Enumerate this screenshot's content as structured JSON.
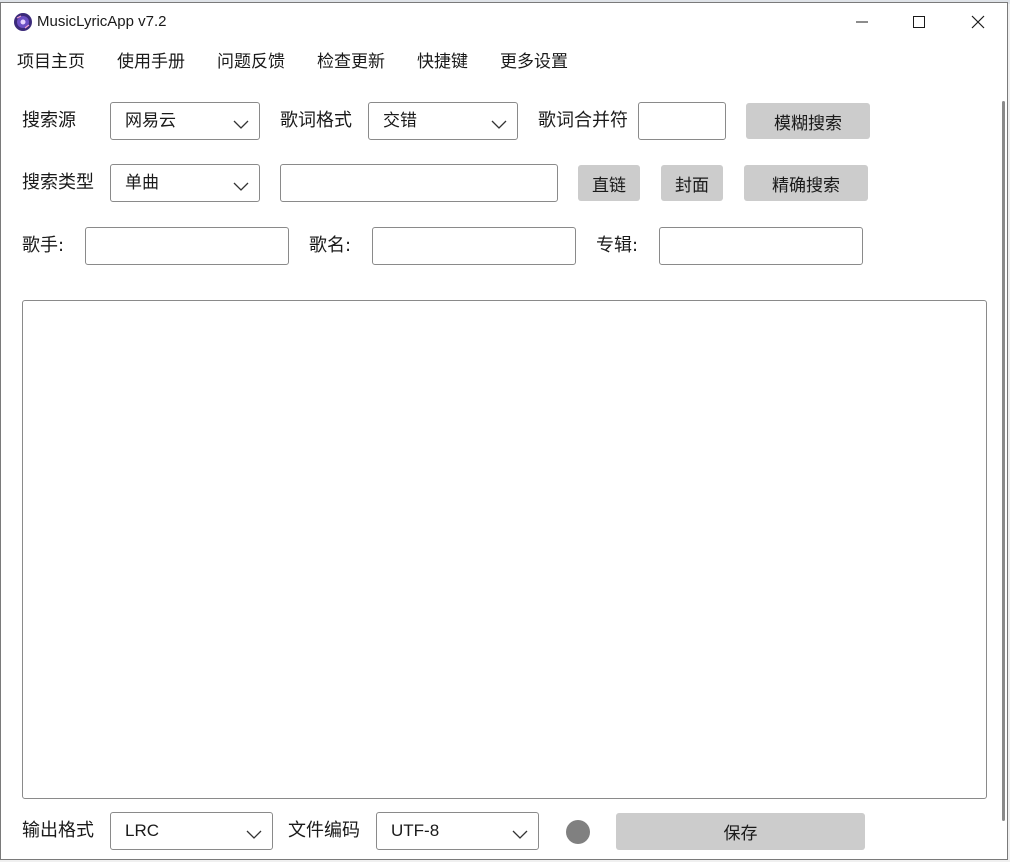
{
  "window": {
    "title": "MusicLyricApp v7.2"
  },
  "menu": {
    "items": [
      "项目主页",
      "使用手册",
      "问题反馈",
      "检查更新",
      "快捷键",
      "更多设置"
    ]
  },
  "search": {
    "source_label": "搜索源",
    "source_value": "网易云",
    "lyric_format_label": "歌词格式",
    "lyric_format_value": "交错",
    "merge_char_label": "歌词合并符",
    "merge_char_value": "",
    "fuzzy_search_label": "模糊搜索",
    "type_label": "搜索类型",
    "type_value": "单曲",
    "query_value": "",
    "direct_link_label": "直链",
    "cover_label": "封面",
    "exact_search_label": "精确搜索",
    "singer_label": "歌手:",
    "song_label": "歌名:",
    "album_label": "专辑:"
  },
  "output": {
    "format_label": "输出格式",
    "format_value": "LRC",
    "encoding_label": "文件编码",
    "encoding_value": "UTF-8",
    "save_label": "保存",
    "status_color": "#808080"
  },
  "icons": {
    "app": "music-disc-icon",
    "minimize": "minimize-icon",
    "maximize": "maximize-icon",
    "close": "close-icon",
    "dropdown": "chevron-down-icon"
  }
}
